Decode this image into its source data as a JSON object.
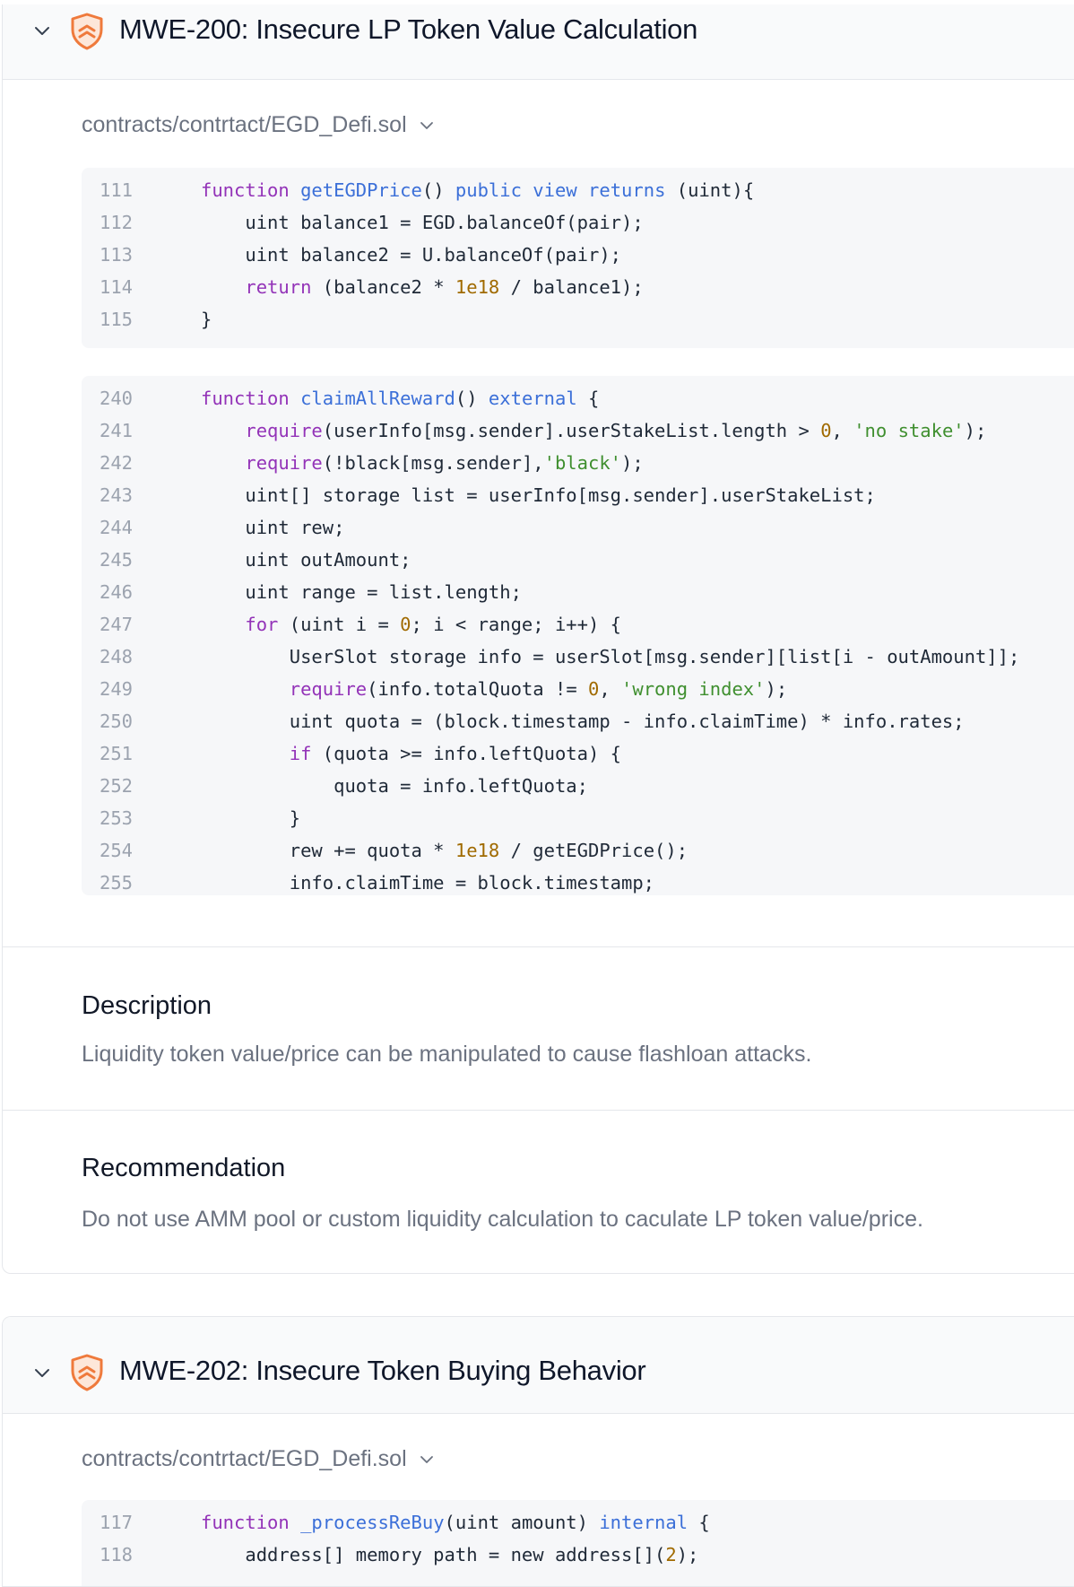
{
  "findings": [
    {
      "title": "MWE-200: Insecure LP Token Value Calculation",
      "file": "contracts/contrtact/EGD_Defi.sol",
      "description_heading": "Description",
      "description": "Liquidity token value/price can be manipulated to cause flashloan attacks.",
      "recommendation_heading": "Recommendation",
      "recommendation": "Do not use AMM pool or custom liquidity calculation to caculate LP token value/price."
    },
    {
      "title": "MWE-202: Insecure Token Buying Behavior",
      "file": "contracts/contrtact/EGD_Defi.sol"
    }
  ],
  "code_blocks": [
    {
      "lines": [
        {
          "n": "111",
          "code": "function getEGDPrice() public view returns (uint){"
        },
        {
          "n": "112",
          "code": "    uint balance1 = EGD.balanceOf(pair);"
        },
        {
          "n": "113",
          "code": "    uint balance2 = U.balanceOf(pair);"
        },
        {
          "n": "114",
          "code": "    return (balance2 * 1e18 / balance1);"
        },
        {
          "n": "115",
          "code": "}"
        }
      ]
    },
    {
      "lines": [
        {
          "n": "240",
          "code": "function claimAllReward() external {"
        },
        {
          "n": "241",
          "code": "    require(userInfo[msg.sender].userStakeList.length > 0, 'no stake');"
        },
        {
          "n": "242",
          "code": "    require(!black[msg.sender],'black');"
        },
        {
          "n": "243",
          "code": "    uint[] storage list = userInfo[msg.sender].userStakeList;"
        },
        {
          "n": "244",
          "code": "    uint rew;"
        },
        {
          "n": "245",
          "code": "    uint outAmount;"
        },
        {
          "n": "246",
          "code": "    uint range = list.length;"
        },
        {
          "n": "247",
          "code": "    for (uint i = 0; i < range; i++) {"
        },
        {
          "n": "248",
          "code": "        UserSlot storage info = userSlot[msg.sender][list[i - outAmount]];"
        },
        {
          "n": "249",
          "code": "        require(info.totalQuota != 0, 'wrong index');"
        },
        {
          "n": "250",
          "code": "        uint quota = (block.timestamp - info.claimTime) * info.rates;"
        },
        {
          "n": "251",
          "code": "        if (quota >= info.leftQuota) {"
        },
        {
          "n": "252",
          "code": "            quota = info.leftQuota;"
        },
        {
          "n": "253",
          "code": "        }"
        },
        {
          "n": "254",
          "code": "        rew += quota * 1e18 / getEGDPrice();"
        },
        {
          "n": "255",
          "code": "        info.claimTime = block.timestamp;"
        }
      ]
    },
    {
      "lines": [
        {
          "n": "117",
          "code": "function _processReBuy(uint amount) internal {"
        },
        {
          "n": "118",
          "code": "    address[] memory path = new address[](2);"
        }
      ]
    }
  ],
  "icons": {
    "collapse": "chevron-down-icon",
    "severity": "shield-warning-icon",
    "file_dropdown": "chevron-down-icon"
  },
  "colors": {
    "severity_orange": "#ef7a3c",
    "keyword": "#9333b8",
    "function": "#3b6fd8",
    "number": "#a06a00",
    "string": "#3f8f2f"
  }
}
